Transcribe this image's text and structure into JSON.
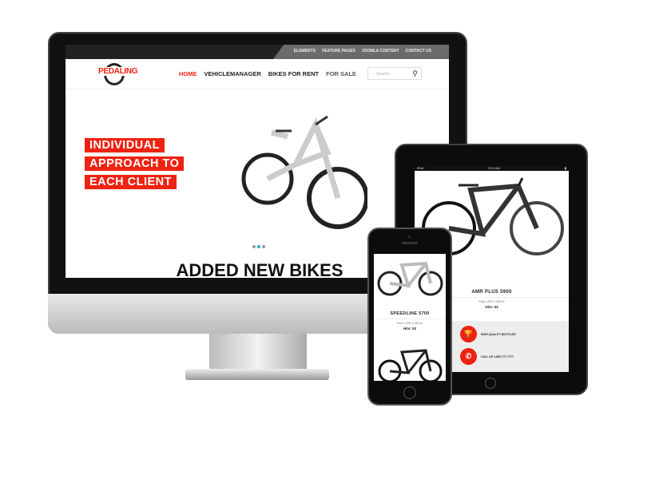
{
  "desktop": {
    "top_links": [
      "ELEMENTS",
      "FEATURE PAGES",
      "JOOMLA CONTENT",
      "CONTACT US"
    ],
    "logo": "PEDALING",
    "nav": [
      "HOME",
      "VEHICLEMANAGER",
      "BIKES FOR RENT",
      "FOR SALE"
    ],
    "search_placeholder": "Search...",
    "hero_lines": [
      "INDIVIDUAL",
      "APPROACH TO",
      "EACH CLIENT"
    ],
    "section_title": "ADDED NEW BIKES",
    "accent": "#e21b1b"
  },
  "tablet": {
    "status_left": "iPad",
    "status_center": "9:54 AM",
    "product": {
      "name": "AMR PLUS 5900",
      "price": "Price: USD 3 999.00",
      "hits": "Hits: 54"
    },
    "features": [
      "HIGH QUALITY BICYCLES",
      "CALL US 1-800-777-7777"
    ]
  },
  "phone": {
    "product": {
      "name": "SPEEDLINE 5700",
      "price": "Price: USD 1 199.00",
      "hits": "Hits: 52"
    }
  }
}
